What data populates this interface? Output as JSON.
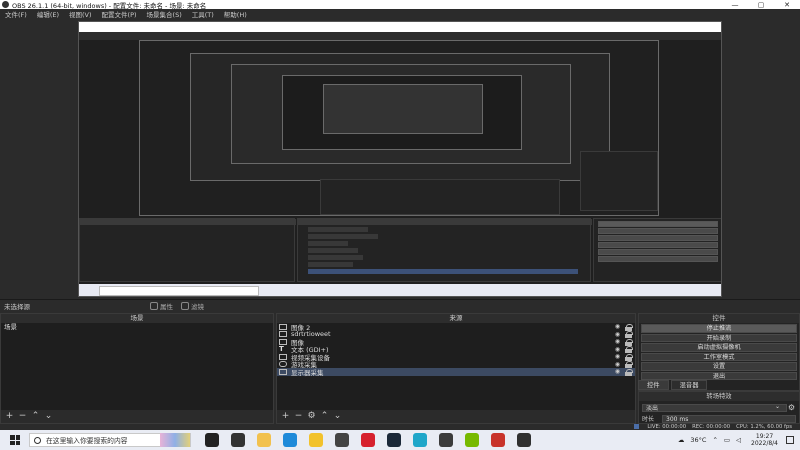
{
  "window": {
    "title": "OBS 26.1.1 (64-bit, windows) - 配置文件: 未命名 - 场景: 未命名",
    "controls": [
      "—",
      "▢",
      "✕"
    ]
  },
  "menu": [
    "文件(F)",
    "编辑(E)",
    "视图(V)",
    "配置文件(P)",
    "场景集合(S)",
    "工具(T)",
    "帮助(H)"
  ],
  "preview": {
    "no_source_label": "未选择源",
    "properties_label": "属性",
    "filters_label": "滤镜"
  },
  "scenes": {
    "header": "场景",
    "items": [
      "场景"
    ]
  },
  "sources": {
    "header": "来源",
    "items": [
      {
        "name": "图像 2",
        "icon": "image-icon"
      },
      {
        "name": "sdrtrtioweet",
        "icon": "image-icon"
      },
      {
        "name": "图像",
        "icon": "image-icon"
      },
      {
        "name": "文本 (GDI+)",
        "icon": "text-icon"
      },
      {
        "name": "视频采集设备",
        "icon": "camera-icon"
      },
      {
        "name": "游戏采集",
        "icon": "gamepad-icon"
      },
      {
        "name": "显示器采集",
        "icon": "monitor-icon"
      }
    ],
    "selected_index": 6
  },
  "controls": {
    "header": "控件",
    "buttons": [
      "停止推流",
      "开始录制",
      "启动虚拟摄像机",
      "工作室模式",
      "设置",
      "退出"
    ],
    "active_button_index": 0
  },
  "tabs": [
    "控件",
    "混音器"
  ],
  "transitions": {
    "header": "转场特效",
    "selected": "淡出",
    "duration_label": "时长",
    "duration_value": "300 ms"
  },
  "status": {
    "live": "LIVE: 00:00:00",
    "rec": "REC: 00:00:00",
    "cpu": "CPU: 1.2%, 60.00 fps"
  },
  "taskbar": {
    "search_placeholder": "在这里输入你要搜索的内容",
    "weather": "36°C",
    "time": "19:27",
    "date": "2022/8/4",
    "icons": [
      {
        "name": "task-view-icon",
        "color": "#222222"
      },
      {
        "name": "sticky-icon",
        "color": "#333333"
      },
      {
        "name": "file-explorer-icon",
        "color": "#f2c14e"
      },
      {
        "name": "edge-icon",
        "color": "#1f8ad9"
      },
      {
        "name": "chrome-icon",
        "color": "#f2c22c"
      },
      {
        "name": "app-icon",
        "color": "#444444"
      },
      {
        "name": "netease-icon",
        "color": "#d6202d"
      },
      {
        "name": "steam-icon",
        "color": "#1b2838"
      },
      {
        "name": "app2-icon",
        "color": "#1fa6c9"
      },
      {
        "name": "app3-icon",
        "color": "#3c3c3c"
      },
      {
        "name": "nvidia-icon",
        "color": "#76b900"
      },
      {
        "name": "app4-icon",
        "color": "#c8332b"
      },
      {
        "name": "obs-icon",
        "color": "#303030"
      }
    ]
  }
}
